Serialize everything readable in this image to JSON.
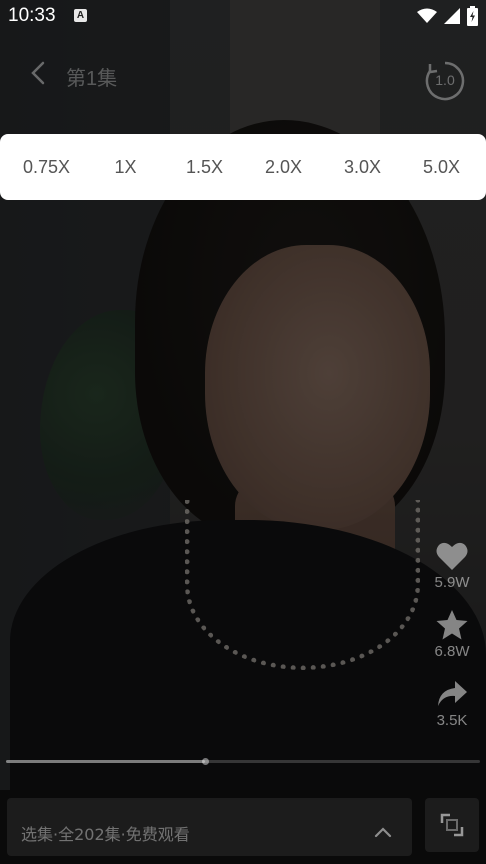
{
  "status_bar": {
    "time": "10:33",
    "app_badge": "A"
  },
  "header": {
    "title": "第1集",
    "speed_value": "1.0"
  },
  "speed_panel": {
    "options": [
      "0.75X",
      "1X",
      "1.5X",
      "2.0X",
      "3.0X",
      "5.0X"
    ]
  },
  "side_actions": {
    "like_count": "5.9W",
    "favorite_count": "6.8W",
    "share_count": "3.5K"
  },
  "playback": {
    "progress_fraction": 0.42
  },
  "bottom_bar": {
    "episode_selector_label": "选集·全202集·免费观看"
  },
  "colors": {
    "panel_bg": "#ffffff",
    "panel_text": "#555555",
    "bottom_bg": "#0a0a0a",
    "control_bg": "#1c1c1c"
  },
  "icons": {
    "back": "chevron-left-icon",
    "speed": "speed-dial-icon",
    "like": "heart-icon",
    "favorite": "star-icon",
    "share": "share-arrow-icon",
    "episodes": "chevron-up-icon",
    "fullscreen": "fullscreen-icon",
    "wifi": "wifi-icon",
    "signal": "signal-icon",
    "battery": "battery-icon"
  }
}
